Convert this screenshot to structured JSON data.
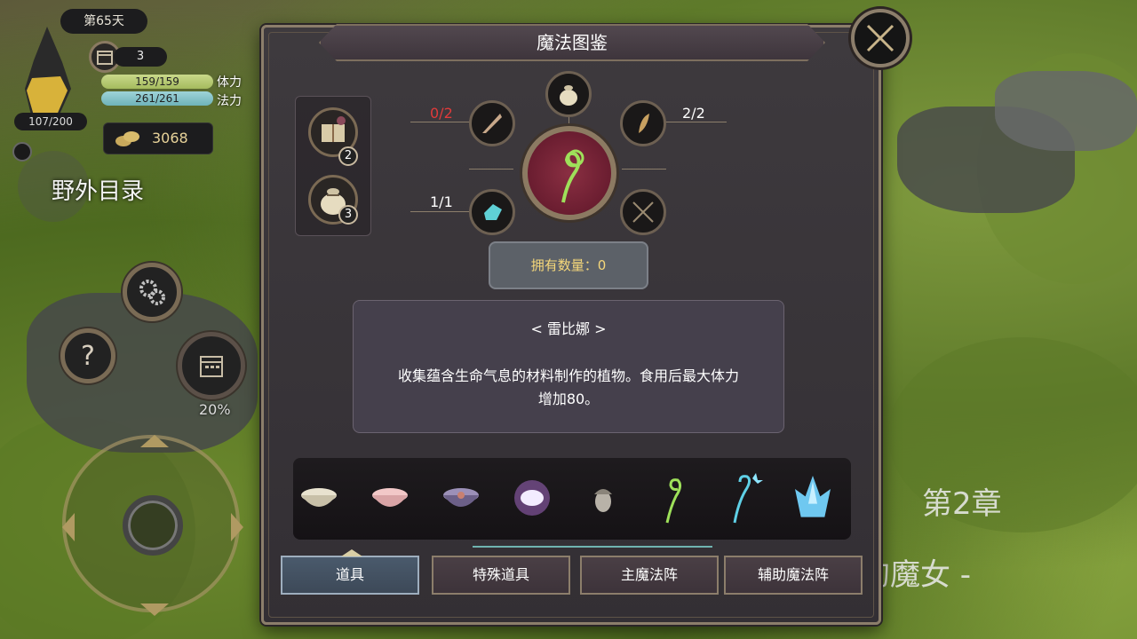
{
  "hud": {
    "day": "第65天",
    "crystal_value": "107/200",
    "calendar_count": "3",
    "stamina_value": "159/159",
    "stamina_label": "体力",
    "mana_value": "261/261",
    "mana_label": "法力",
    "gold": "3068",
    "wild_menu_label": "野外目录",
    "progress_pct": "20%",
    "help_glyph": "?"
  },
  "background": {
    "chapter": "第2章",
    "subtitle": "的魔女 -"
  },
  "modal": {
    "title": "魔法图鉴",
    "ingredients": [
      {
        "icon": "scroll-book-icon",
        "count": "2"
      },
      {
        "icon": "sack-icon",
        "count": "3"
      }
    ],
    "recipe_counts": {
      "top_left": "0/2",
      "top_right": "2/2",
      "bottom_left": "1/1"
    },
    "owned_text": "拥有数量：0",
    "item_name": "< 雷比娜 >",
    "item_description_line1": "收集蕴含生命气息的材料制作的植物。食用后最大体力",
    "item_description_line2": "增加80。",
    "strip_items": [
      "bowl-cream-icon",
      "bowl-pink-icon",
      "bowl-purple-icon",
      "glow-orb-icon",
      "acorn-icon",
      "green-sprout-icon",
      "blue-staff-icon",
      "ice-crystal-icon"
    ],
    "tabs": [
      "道具",
      "特殊道具",
      "主魔法阵",
      "辅助魔法阵"
    ]
  },
  "colors": {
    "accent_gold": "#8c7e6b",
    "owned_text": "#f5d77a",
    "warn_red": "#e03a3a",
    "center_red": "#7a2236"
  }
}
